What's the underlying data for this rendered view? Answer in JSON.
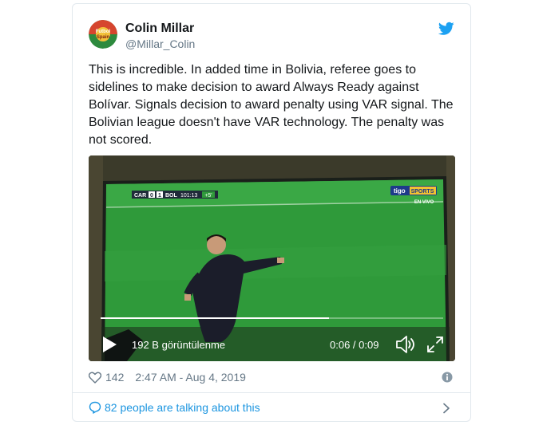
{
  "author": {
    "name": "Colin Millar",
    "handle": "@Millar_Colin",
    "avatar_text": "Futbol Spain"
  },
  "tweet": {
    "text_lines": [
      "This is incredible. In added time in Bolivia, referee goes to",
      "sidelines to make decision to award Always Ready against",
      "Bolívar. Signals decision to award penalty using VAR signal. The",
      "Bolivian league doesn't have VAR technology. The penalty was",
      "not scored."
    ]
  },
  "video": {
    "scoreboard": {
      "home": "CAR",
      "home_score": "0",
      "away_score": "1",
      "away": "BOL",
      "clock": "101:13",
      "added": "+5'"
    },
    "broadcaster": {
      "logo_left": "tigo",
      "logo_right": "SPORTS",
      "live_label": "EN VIVO"
    },
    "views_label": "192 B görüntülenme",
    "time_label": "0:06 / 0:09",
    "progress": 0.667
  },
  "meta": {
    "likes": "142",
    "timestamp": "2:47 AM - Aug 4, 2019"
  },
  "talking": {
    "label": "82 people are talking about this"
  },
  "colors": {
    "link_blue": "#1b95e0",
    "twitter_blue": "#1da1f2",
    "secondary_text": "#657786",
    "pitch_green": "#2f9a3a"
  },
  "icons": [
    "twitter-bird-icon",
    "play-icon",
    "volume-icon",
    "fullscreen-icon",
    "heart-icon",
    "info-icon",
    "comment-bubble-icon",
    "chevron-right-icon"
  ]
}
